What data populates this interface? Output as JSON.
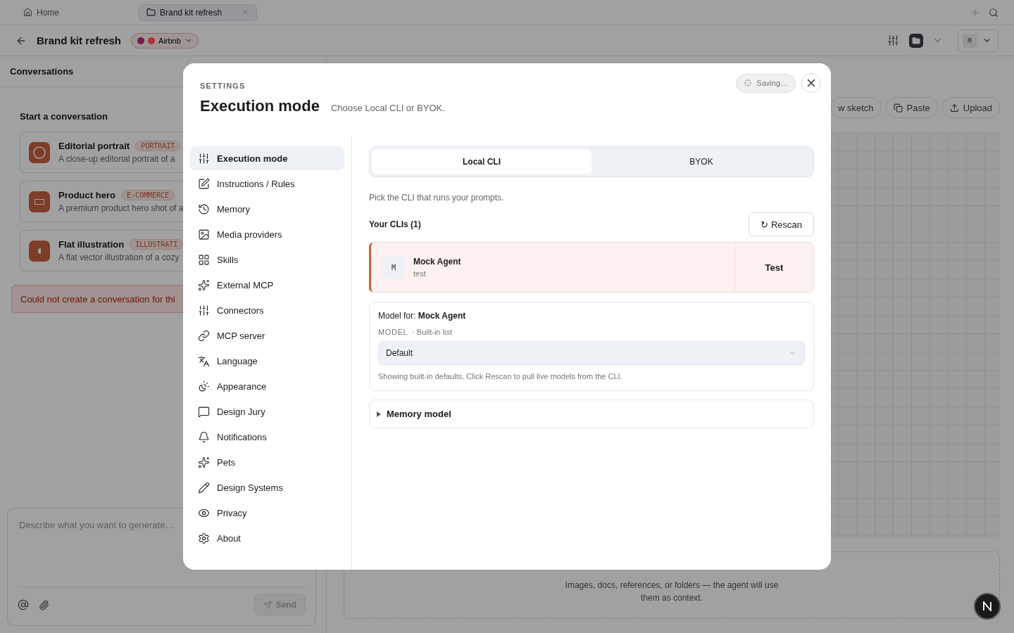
{
  "browser_tabs": [
    {
      "label": "Home",
      "selected": false
    },
    {
      "label": "Brand kit refresh",
      "selected": true
    }
  ],
  "header": {
    "title": "Brand kit refresh",
    "brand": {
      "label": "Airbnb",
      "dots": [
        {
          "color": "#761c4a"
        },
        {
          "color": "#b3303f"
        }
      ]
    },
    "avatar": "M"
  },
  "conversations": {
    "title": "Conversations",
    "section": "Start a conversation",
    "templates": [
      {
        "kind": "portrait",
        "title": "Editorial portrait",
        "tag": "PORTRAIT",
        "description": "A close-up editorial portrait of a"
      },
      {
        "kind": "product",
        "title": "Product hero",
        "tag": "E-COMMERCE",
        "description": "A premium product hero shot of a"
      },
      {
        "kind": "illustration",
        "title": "Flat illustration",
        "tag": "ILLUSTRATI",
        "description": "A flat vector illustration of a cozy"
      }
    ],
    "error": "Could not create a conversation for thi"
  },
  "composer": {
    "placeholder": "Describe what you want to generate…",
    "send": {
      "label": "Send",
      "disabled": true
    }
  },
  "canvas": {
    "actions": [
      {
        "kind": "sketch",
        "label": "w sketch"
      },
      {
        "kind": "paste",
        "label": "Paste"
      },
      {
        "kind": "upload",
        "label": "Upload"
      }
    ],
    "drop_hint": "Images, docs, references, or folders — the agent will use them as context."
  },
  "settings": {
    "eyebrow": "SETTINGS",
    "title": "Execution mode",
    "subtitle": "Choose Local CLI or BYOK.",
    "status": "Saving…",
    "nav": [
      {
        "label": "Execution mode",
        "selected": true
      },
      {
        "label": "Instructions / Rules",
        "selected": false
      },
      {
        "label": "Memory",
        "selected": false
      },
      {
        "label": "Media providers",
        "selected": false
      },
      {
        "label": "Skills",
        "selected": false
      },
      {
        "label": "External MCP",
        "selected": false
      },
      {
        "label": "Connectors",
        "selected": false
      },
      {
        "label": "MCP server",
        "selected": false
      },
      {
        "label": "Language",
        "selected": false
      },
      {
        "label": "Appearance",
        "selected": false
      },
      {
        "label": "Design Jury",
        "selected": false
      },
      {
        "label": "Notifications",
        "selected": false
      },
      {
        "label": "Pets",
        "selected": false
      },
      {
        "label": "Design Systems",
        "selected": false
      },
      {
        "label": "Privacy",
        "selected": false
      },
      {
        "label": "About",
        "selected": false
      }
    ],
    "modes": [
      {
        "label": "Local CLI",
        "selected": true
      },
      {
        "label": "BYOK",
        "selected": false
      }
    ],
    "hint": "Pick the CLI that runs your prompts.",
    "clis_title": "Your CLIs (1)",
    "rescan": "↻ Rescan",
    "clis": [
      {
        "initial": "M",
        "name": "Mock Agent",
        "detail": "test",
        "selected": true,
        "action": "Test"
      }
    ],
    "model": {
      "label": "Model for: **Mock Agent**",
      "field": "MODEL",
      "source": "· Built-in list",
      "value": "Default",
      "note": "Showing built-in defaults. Click Rescan to pull live models from the CLI."
    },
    "memory_model": {
      "label": "Memory model",
      "expanded": false
    }
  }
}
